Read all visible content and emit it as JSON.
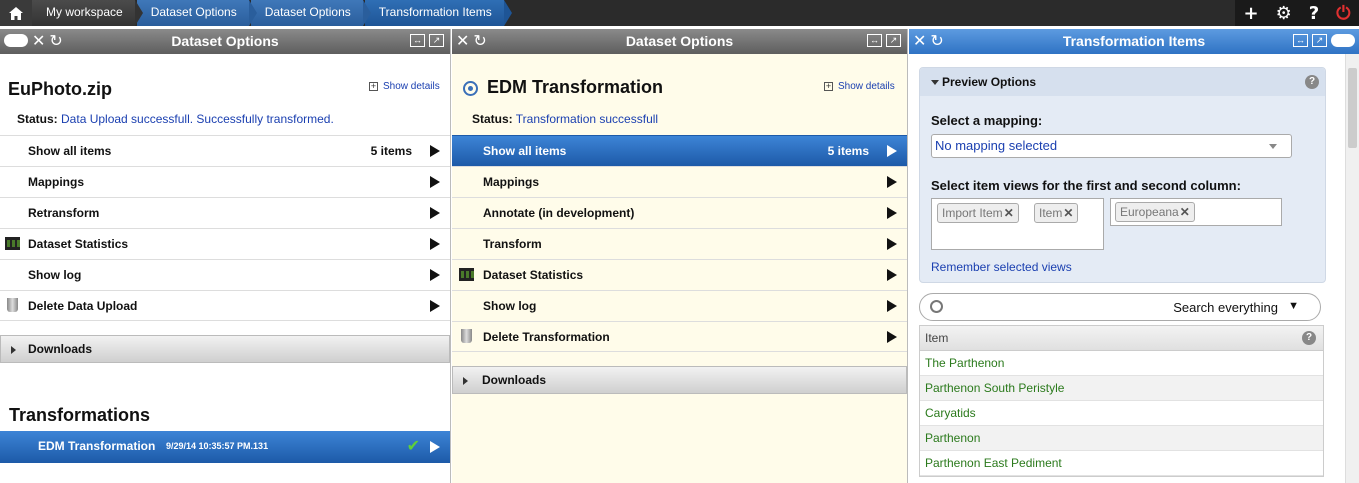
{
  "topbar": {
    "breadcrumbs": [
      "My workspace",
      "Dataset Options",
      "Dataset Options",
      "Transformation Items"
    ]
  },
  "panel1": {
    "title": "Dataset Options",
    "dataset_name": "EuPhoto.zip",
    "show_details": "Show details",
    "status_label": "Status:",
    "status_value": "Data Upload successfull. Successfully transformed.",
    "menu": [
      {
        "label": "Show all items",
        "count": "5 items"
      },
      {
        "label": "Mappings"
      },
      {
        "label": "Retransform"
      },
      {
        "label": "Dataset Statistics",
        "icon": "film-icon"
      },
      {
        "label": "Show log"
      },
      {
        "label": "Delete Data Upload",
        "icon": "trash-icon"
      }
    ],
    "downloads": "Downloads",
    "transformations_title": "Transformations",
    "transformation": {
      "name": "EDM Transformation",
      "date": "9/29/14 10:35:57 PM.131"
    }
  },
  "panel2": {
    "title": "Dataset Options",
    "dataset_name": "EDM Transformation",
    "show_details": "Show details",
    "status_label": "Status:",
    "status_value": "Transformation successfull",
    "menu": [
      {
        "label": "Show all items",
        "count": "5 items"
      },
      {
        "label": "Mappings"
      },
      {
        "label": "Annotate (in development)"
      },
      {
        "label": "Transform"
      },
      {
        "label": "Dataset Statistics",
        "icon": "film-icon"
      },
      {
        "label": "Show log"
      },
      {
        "label": "Delete Transformation",
        "icon": "trash-icon"
      }
    ],
    "downloads": "Downloads"
  },
  "panel3": {
    "title": "Transformation Items",
    "preview_options": "Preview Options",
    "select_mapping_label": "Select a mapping:",
    "mapping_selected": "No mapping selected",
    "views_label": "Select item views for the first and second column:",
    "first_column_tags": [
      "Import Item",
      "Item"
    ],
    "second_column_tags": [
      "Europeana"
    ],
    "remember": "Remember selected views",
    "search_scope": "Search everything",
    "table_header": "Item",
    "items": [
      "The Parthenon",
      "Parthenon South Peristyle",
      "Caryatids",
      "Parthenon",
      "Parthenon East Pediment"
    ]
  },
  "colors": {
    "accent": "#2f73c4",
    "link": "#1a3fb0",
    "item_green": "#2b7a1c",
    "panel2_bg": "#fffcea"
  }
}
